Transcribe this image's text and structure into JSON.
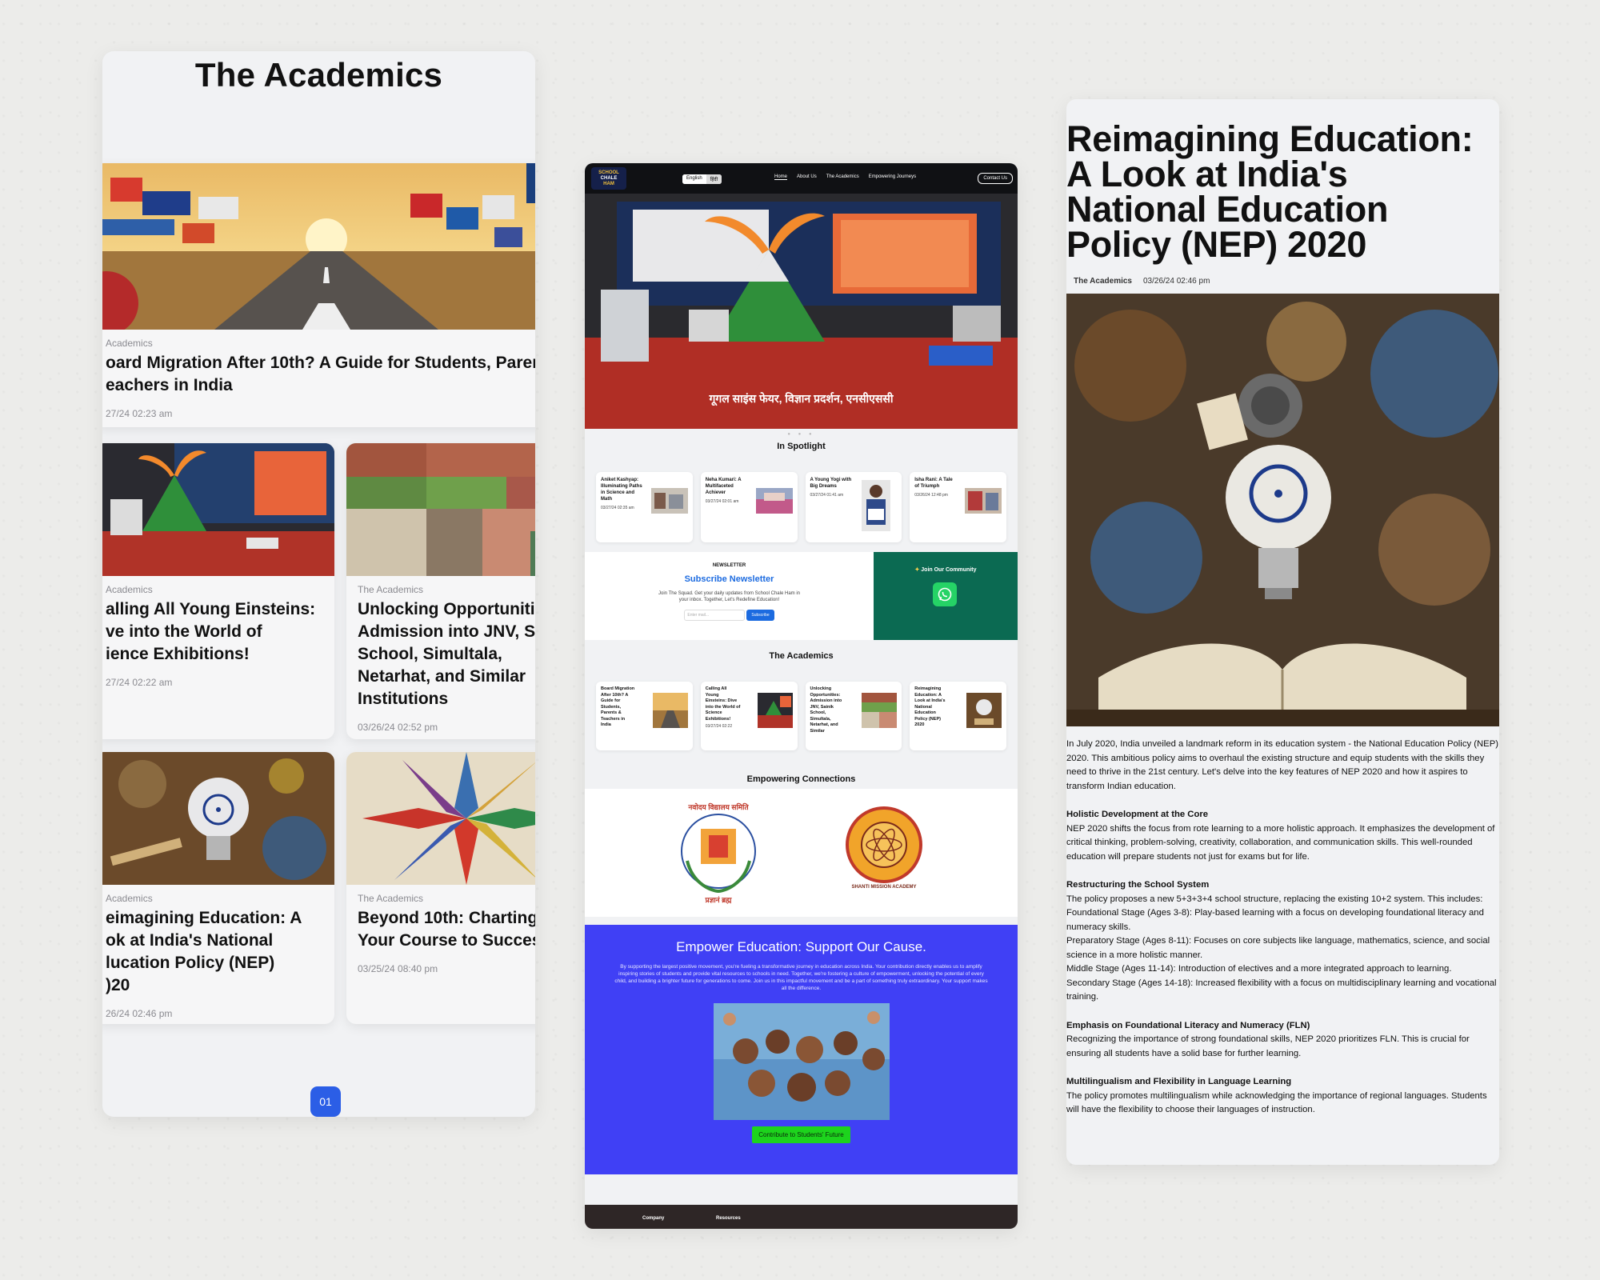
{
  "panel1": {
    "title": "The Academics",
    "featured": {
      "category": "Academics",
      "title": "oard Migration After 10th? A Guide for Students, Parent\neachers in India",
      "date": "27/24 02:23 am"
    },
    "cards": [
      {
        "category": "Academics",
        "title": "alling All Young Einsteins:\nve into the World of\nience Exhibitions!",
        "date": "27/24 02:22 am"
      },
      {
        "category": "The Academics",
        "title": "Unlocking Opportunitie\nAdmission into JNV, Sai\nSchool, Simultala,\nNetarhat, and Similar\nInstitutions",
        "date": "03/26/24 02:52 pm"
      },
      {
        "category": "Academics",
        "title": "eimagining Education: A\nok at India's National\nlucation Policy (NEP)\n)20",
        "date": "26/24 02:46 pm"
      },
      {
        "category": "The Academics",
        "title": "Beyond 10th: Charting\nYour Course to Success",
        "date": "03/25/24 08:40 pm"
      }
    ],
    "page": "01"
  },
  "panel2": {
    "logo": [
      "SCHOOL",
      "CHALE",
      "HAM"
    ],
    "lang": [
      "English",
      "हिंदी"
    ],
    "nav": [
      "Home",
      "About Us",
      "The Academics",
      "Empowering Journeys"
    ],
    "contact": "Contact Us",
    "hero_caption": "गूगल साइंस फेयर, विज्ञान प्रदर्शन, एनसीएससी",
    "spotlight_title": "In Spotlight",
    "spotlight": [
      {
        "title": "Aniket Kashyap: Illuminating Paths in Science and Math",
        "date": "03/27/24 02:35 am"
      },
      {
        "title": "Neha Kumari: A Multifaceted Achiever",
        "date": "03/27/24 02:01 am"
      },
      {
        "title": "A Young Yogi with Big Dreams",
        "date": "03/27/24 01:41 am"
      },
      {
        "title": "Isha Rani: A Tale of Triumph",
        "date": "03/26/24 12:48 pm"
      }
    ],
    "newsletter": {
      "small": "NEWSLETTER",
      "title": "Subscribe Newsletter",
      "desc": "Join The Squad. Get your daily updates from School Chale Ham in your inbox. Together, Let's Redefine Education!",
      "placeholder": "Enter mail...",
      "button": "Subscribe"
    },
    "community": "Join Our Community",
    "academics_title": "The Academics",
    "academics": [
      {
        "title": "Board Migration After 10th? A Guide for Students, Parents & Teachers in India",
        "date": ""
      },
      {
        "title": "Calling All Young Einsteins: Dive into the World of Science Exhibitions!",
        "date": "03/27/24 02:22"
      },
      {
        "title": "Unlocking Opportunities: Admission into JNV, Sainik School, Simultala, Netarhat, and Similar",
        "date": ""
      },
      {
        "title": "Reimagining Education: A Look at India's National Education Policy (NEP) 2020",
        "date": ""
      }
    ],
    "connections_title": "Empowering Connections",
    "seal1_text": "नवोदय विद्यालय समिति",
    "seal1_motto": "प्रज्ञानं ब्रह्म",
    "seal2_text": "SHANTI MISSION ACADEMY",
    "support": {
      "title": "Empower Education: Support Our Cause.",
      "body": "By supporting the largest positive movement, you're fueling a transformative journey in education across India. Your contribution directly enables us to amplify inspiring stories of students and provide vital resources to schools in need. Together, we're fostering a culture of empowerment, unlocking the potential of every child, and building a brighter future for generations to come. Join us in this impactful movement and be a part of something truly extraordinary. Your support makes all the difference.",
      "button": "Contribute to Students' Future"
    },
    "footer": [
      "Company",
      "Resources"
    ]
  },
  "panel3": {
    "title": "Reimagining Education: A Look at India's National Education Policy (NEP) 2020",
    "category": "The Academics",
    "date": "03/26/24 02:46 pm",
    "intro": "In July 2020, India unveiled a landmark reform in its education system - the National Education Policy (NEP) 2020. This ambitious policy aims to overhaul the existing structure and equip students with the skills they need to thrive in the 21st century. Let's delve into the key features of NEP 2020 and how it aspires to transform Indian education.",
    "s1_h": "Holistic Development at the Core",
    "s1_p": "NEP 2020 shifts the focus from rote learning to a more holistic approach. It emphasizes the development of critical thinking, problem-solving, creativity, collaboration, and communication skills. This well-rounded education will prepare students not just for exams but for life.",
    "s2_h": "Restructuring the School System",
    "s2_p": "The policy proposes a new 5+3+3+4 school structure, replacing the existing 10+2 system. This includes:",
    "s2_l1": "Foundational Stage (Ages 3-8): Play-based learning with a focus on developing foundational literacy and numeracy skills.",
    "s2_l2": "Preparatory Stage (Ages 8-11): Focuses on core subjects like language, mathematics, science, and social science in a more holistic manner.",
    "s2_l3": "Middle Stage (Ages 11-14): Introduction of electives and a more integrated approach to learning.",
    "s2_l4": "Secondary Stage (Ages 14-18): Increased flexibility with a focus on multidisciplinary learning and vocational training.",
    "s3_h": "Emphasis on Foundational Literacy and Numeracy (FLN)",
    "s3_p": "Recognizing the importance of strong foundational skills, NEP 2020 prioritizes FLN. This is crucial for ensuring all students have a solid base for further learning.",
    "s4_h": "Multilingualism and Flexibility in Language Learning",
    "s4_p": "The policy promotes multilingualism while acknowledging the importance of regional languages. Students will have the flexibility to choose their languages of instruction."
  }
}
